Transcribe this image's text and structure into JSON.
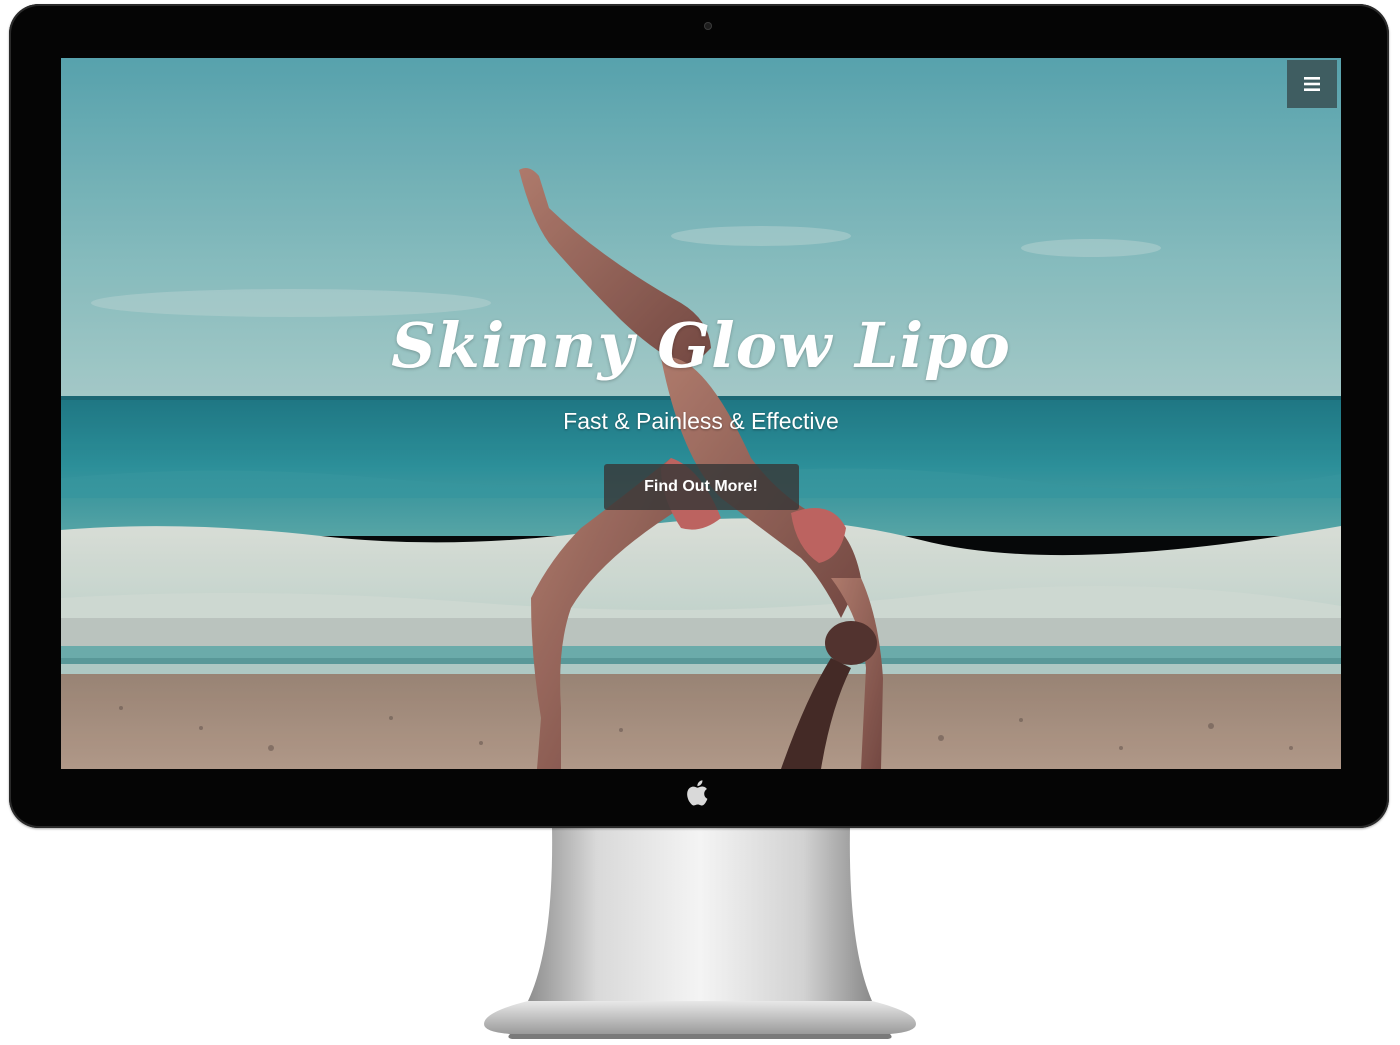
{
  "hero": {
    "title": "Skinny Glow Lipo",
    "subtitle": "Fast & Painless & Effective",
    "cta_label": "Find Out More!"
  },
  "nav": {
    "menu_icon": "hamburger-menu-icon"
  },
  "device": {
    "logo_icon": "apple-logo-icon"
  },
  "colors": {
    "sky_top": "#62b3bd",
    "sky_bottom": "#a6d3d3",
    "sea": "#2e9aa6",
    "foam": "#e9efe6",
    "sand": "#b49a85",
    "menu_button_bg": "#3f5d61",
    "cta_bg": "#373737",
    "bezel": "#050505"
  }
}
